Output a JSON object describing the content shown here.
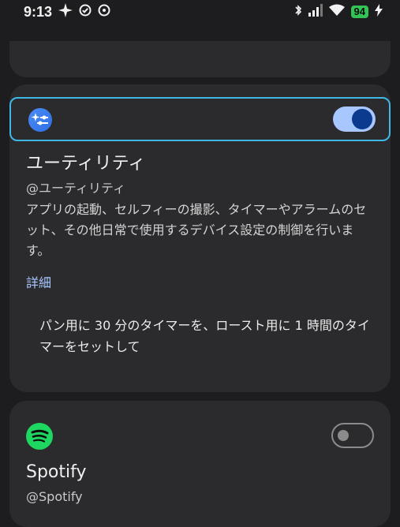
{
  "status_bar": {
    "time": "9:13",
    "battery": "94",
    "icons": [
      "sparkle-icon",
      "check-circle-icon",
      "face-icon",
      "bluetooth-icon",
      "signal-icon",
      "wifi-icon",
      "charging-icon"
    ]
  },
  "utility": {
    "title": "ユーティリティ",
    "handle": "@ユーティリティ",
    "description": "アプリの起動、セルフィーの撮影、タイマーやアラームのセット、その他日常で使用するデバイス設定の制御を行います。",
    "details_link": "詳細",
    "example": "パン用に 30 分のタイマーを、ロースト用に 1 時間のタイマーをセットして",
    "enabled": true,
    "accent": "#3fb8e6"
  },
  "spotify": {
    "title": "Spotify",
    "handle": "@Spotify",
    "enabled": false,
    "brand_color": "#1ed760"
  }
}
